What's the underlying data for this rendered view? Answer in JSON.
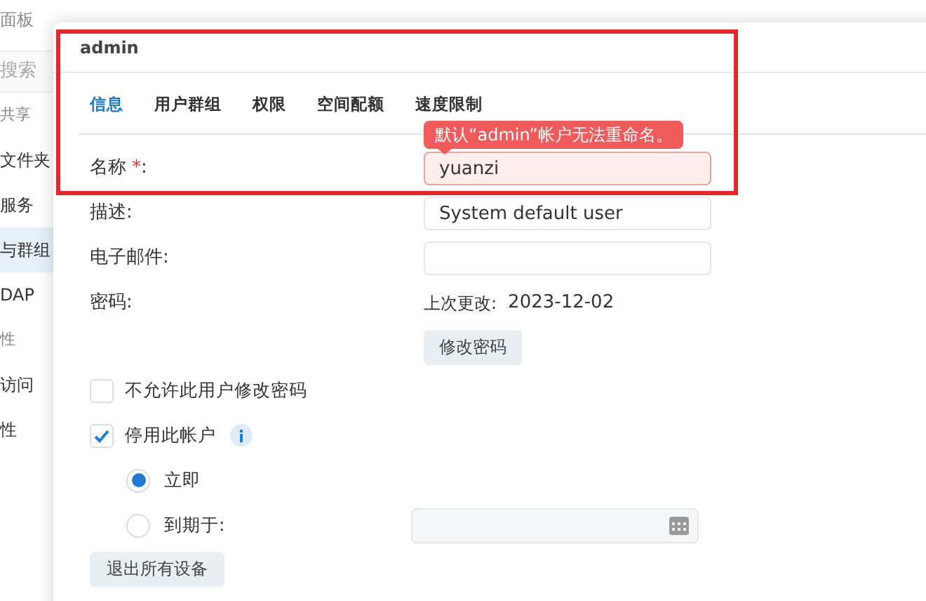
{
  "sidebar": {
    "title": "面板",
    "search": {
      "placeholder": "搜索"
    },
    "items": [
      {
        "label": "共享",
        "kind": "header",
        "selected": false
      },
      {
        "label": "文件夹",
        "kind": "item",
        "selected": false
      },
      {
        "label": "服务",
        "kind": "item",
        "selected": false
      },
      {
        "label": "与群组",
        "kind": "item",
        "selected": true
      },
      {
        "label": "DAP",
        "kind": "item",
        "selected": false
      },
      {
        "label": "性",
        "kind": "header",
        "selected": false
      },
      {
        "label": "访问",
        "kind": "item",
        "selected": false
      },
      {
        "label": "性",
        "kind": "item",
        "selected": false
      }
    ]
  },
  "dialog": {
    "title": "admin",
    "tabs": [
      {
        "label": "信息",
        "selected": true
      },
      {
        "label": "用户群组",
        "selected": false
      },
      {
        "label": "权限",
        "selected": false
      },
      {
        "label": "空间配额",
        "selected": false
      },
      {
        "label": "速度限制",
        "selected": false
      }
    ],
    "tooltip": "默认“admin”帐户无法重命名。",
    "name": {
      "label": "名称",
      "required": "*",
      "suffix": ":",
      "value": "yuanzi",
      "error": true
    },
    "description": {
      "label": "描述:",
      "value": "System default user"
    },
    "email": {
      "label": "电子邮件:"
    },
    "password": {
      "label": "密码:",
      "last_changed_label": "上次更改:",
      "last_changed": "2023-12-02",
      "button": "修改密码"
    },
    "options": [
      {
        "label": "不允许此用户修改密码",
        "checked": false,
        "info": false
      },
      {
        "label": "停用此帐户",
        "checked": true,
        "info": true
      }
    ],
    "disable_mode": [
      {
        "label": "立即",
        "selected": true
      },
      {
        "label": "到期于:",
        "selected": false
      }
    ],
    "logout_button": "退出所有设备"
  },
  "highlight": true
}
